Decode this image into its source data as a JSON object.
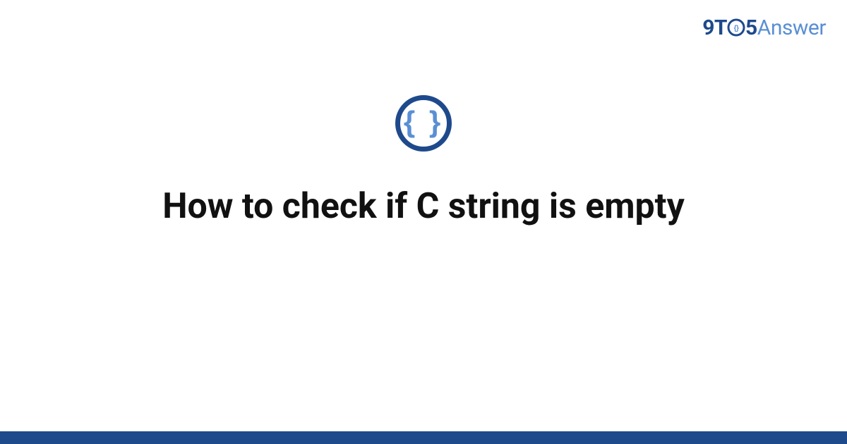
{
  "brand": {
    "part1": "9T",
    "part2": "5",
    "part3": "Answer"
  },
  "icon": {
    "symbol": "{ }",
    "name": "code-braces"
  },
  "title": "How to check if C string is empty",
  "colors": {
    "primary": "#1e4a8c",
    "secondary": "#5a8fd4",
    "text": "#111111"
  }
}
